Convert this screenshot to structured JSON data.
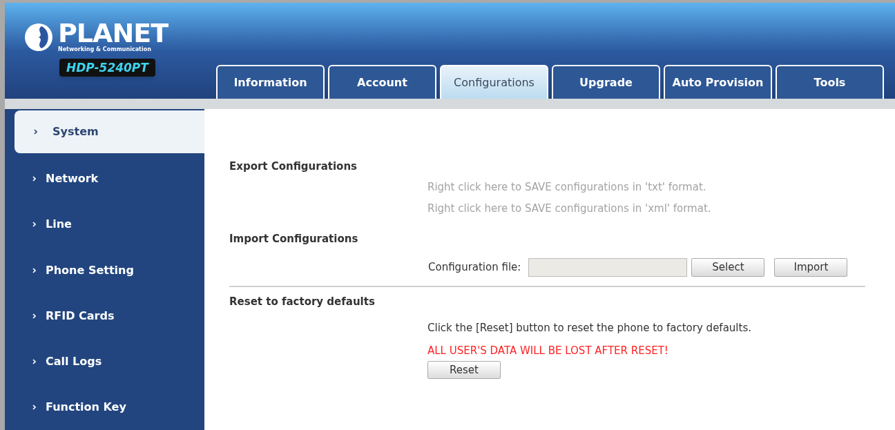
{
  "header": {
    "brand": "PLANET",
    "tagline": "Networking & Communication",
    "model": "HDP-5240PT"
  },
  "tabs": [
    {
      "label": "Information",
      "selected": false
    },
    {
      "label": "Account",
      "selected": false
    },
    {
      "label": "Configurations",
      "selected": true
    },
    {
      "label": "Upgrade",
      "selected": false
    },
    {
      "label": "Auto Provision",
      "selected": false
    },
    {
      "label": "Tools",
      "selected": false
    }
  ],
  "sidebar": {
    "items": [
      {
        "label": "System",
        "selected": true
      },
      {
        "label": "Network",
        "selected": false
      },
      {
        "label": "Line",
        "selected": false
      },
      {
        "label": "Phone Setting",
        "selected": false
      },
      {
        "label": "RFID Cards",
        "selected": false
      },
      {
        "label": "Call Logs",
        "selected": false
      },
      {
        "label": "Function Key",
        "selected": false
      }
    ]
  },
  "export": {
    "title": "Export Configurations",
    "links": [
      "Right click here to SAVE configurations in 'txt' format.",
      "Right click here to SAVE configurations in 'xml' format."
    ]
  },
  "import": {
    "title": "Import Configurations",
    "file_label": "Configuration file:",
    "buttons": [
      "Select",
      "Import"
    ]
  },
  "reset": {
    "title": "Reset to factory defaults",
    "note": "Click the [Reset] button to reset the phone to factory defaults.",
    "warning": "ALL USER'S DATA WILL BE LOST AFTER RESET!",
    "button": "Reset"
  }
}
